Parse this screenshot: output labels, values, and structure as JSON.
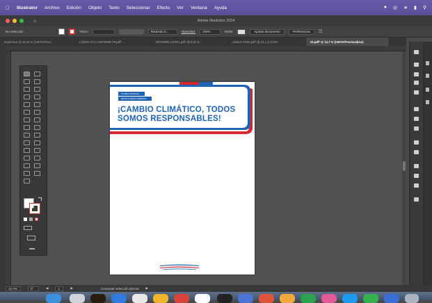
{
  "menubar": {
    "apple_icon": "apple-icon",
    "app_name": "Illustrator",
    "items": [
      "Archivo",
      "Edición",
      "Objeto",
      "Texto",
      "Seleccionar",
      "Efecto",
      "Ver",
      "Ventana",
      "Ayuda"
    ]
  },
  "titlebar": {
    "title": "Adobe Illustrator 2024"
  },
  "controlbar": {
    "selection": "No selección",
    "stroke_label": "Trazo:",
    "brush": "Redondo 5...",
    "opacity_label": "Opacidad:",
    "opacity_value": "100%",
    "style_label": "Estilo:",
    "doc_setup": "Ajustar documento",
    "prefs": "Preferencias"
  },
  "tabs": [
    {
      "label": "Imprimir.ai @ 18,16 % (CMYK/Previ...",
      "active": false
    },
    {
      "label": "LÁGRA AYCA INFORME FP.pdf* ...",
      "active": false
    },
    {
      "label": "INFORME LÁGRA.pdf* @ 8,01 %...",
      "active": false
    },
    {
      "label": "Lámina PG01.pdf* @ 24,1 % (CMY...",
      "active": false
    },
    {
      "label": "01.pdf* @ 12,7 % (CMYK/Previsualizar)",
      "active": true
    }
  ],
  "artboard": {
    "tag1": "ÚLTIMAS NOTICIAS",
    "tag2": "REVISTA MEDIO AMBIENTE",
    "headline_1": "¡CAMBIO CLIMÁTICO, TODOS",
    "headline_2": "SOMOS RESPONSABLES!"
  },
  "statusbar": {
    "zoom": "12,7%",
    "angle": "0°",
    "page": "1",
    "tool": "Conmutar selección directa"
  },
  "colors": {
    "brand_blue": "#1e63b5",
    "brand_red": "#d7282f",
    "menubar": "#5b4f9a"
  }
}
